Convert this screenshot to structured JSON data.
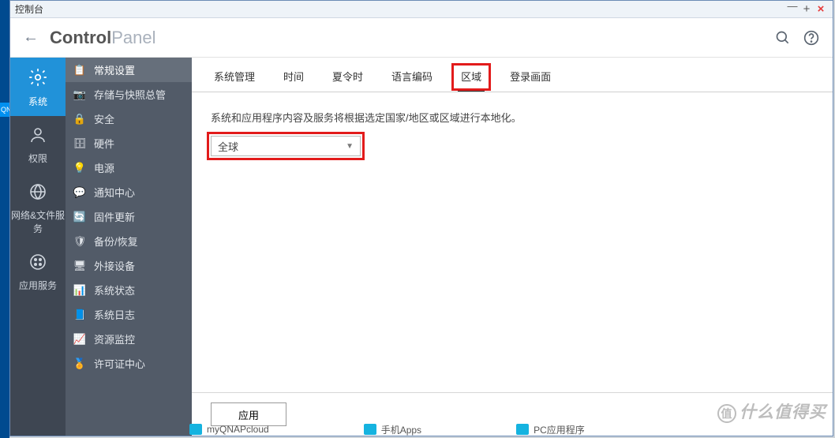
{
  "window": {
    "title": "控制台"
  },
  "header": {
    "brand_bold": "Control",
    "brand_light": "Panel"
  },
  "sidebar_main": [
    {
      "label": "系统",
      "active": true,
      "icon": "gear"
    },
    {
      "label": "权限",
      "active": false,
      "icon": "user"
    },
    {
      "label": "网络&文件服务",
      "active": false,
      "icon": "globe"
    },
    {
      "label": "应用服务",
      "active": false,
      "icon": "grid"
    }
  ],
  "sidebar_sub": [
    {
      "label": "常规设置",
      "active": true,
      "icon": "📋"
    },
    {
      "label": "存储与快照总管",
      "active": false,
      "icon": "📷"
    },
    {
      "label": "安全",
      "active": false,
      "icon": "🔒"
    },
    {
      "label": "硬件",
      "active": false,
      "icon": "🗄"
    },
    {
      "label": "电源",
      "active": false,
      "icon": "💡"
    },
    {
      "label": "通知中心",
      "active": false,
      "icon": "💬"
    },
    {
      "label": "固件更新",
      "active": false,
      "icon": "🔄"
    },
    {
      "label": "备份/恢复",
      "active": false,
      "icon": "🛡"
    },
    {
      "label": "外接设备",
      "active": false,
      "icon": "🖥"
    },
    {
      "label": "系统状态",
      "active": false,
      "icon": "📊"
    },
    {
      "label": "系统日志",
      "active": false,
      "icon": "📘"
    },
    {
      "label": "资源监控",
      "active": false,
      "icon": "📈"
    },
    {
      "label": "许可证中心",
      "active": false,
      "icon": "🏅"
    }
  ],
  "tabs": [
    {
      "label": "系统管理",
      "active": false
    },
    {
      "label": "时间",
      "active": false
    },
    {
      "label": "夏令时",
      "active": false
    },
    {
      "label": "语言编码",
      "active": false
    },
    {
      "label": "区域",
      "active": true,
      "highlight": true
    },
    {
      "label": "登录画面",
      "active": false
    }
  ],
  "panel": {
    "description": "系统和应用程序内容及服务将根据选定国家/地区或区域进行本地化。",
    "region_value": "全球"
  },
  "footer": {
    "apply_label": "应用"
  },
  "watermark": {
    "text": "什么值得买",
    "badge": "值"
  },
  "bottom_apps": [
    "myQNAPcloud",
    "手机Apps",
    "PC应用程序"
  ]
}
